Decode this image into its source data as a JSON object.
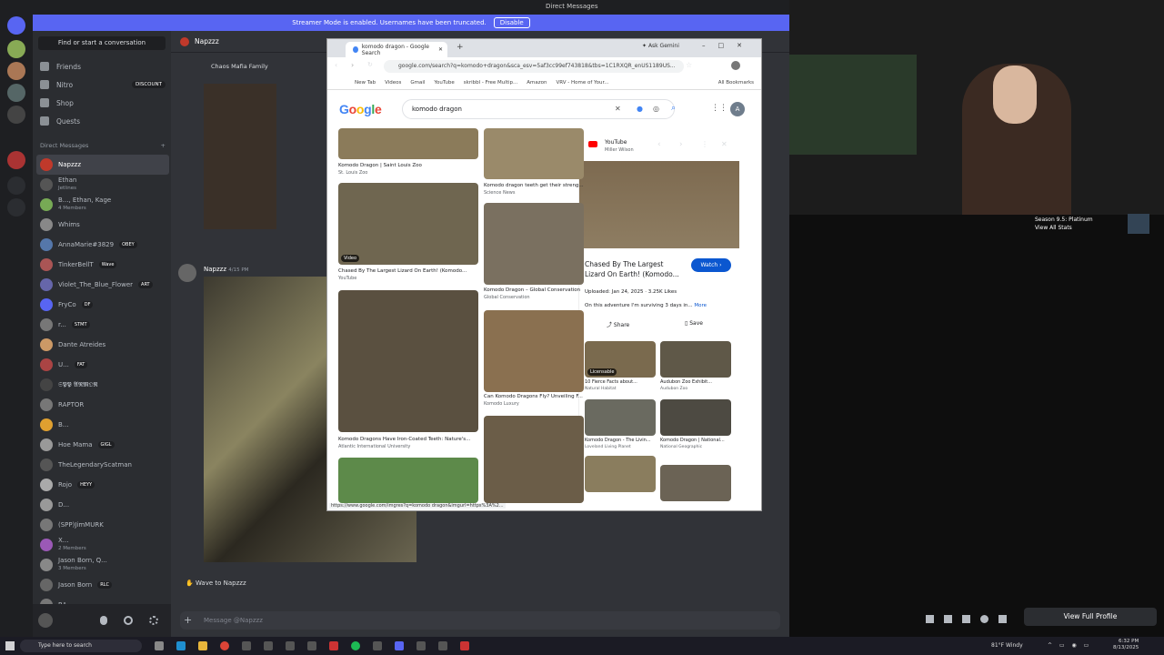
{
  "discord": {
    "window_title": "Direct Messages",
    "streamer_banner": "Streamer Mode is enabled. Usernames have been truncated.",
    "disable_label": "Disable",
    "find_placeholder": "Find or start a conversation",
    "nav": [
      {
        "label": "Friends"
      },
      {
        "label": "Nitro",
        "badge": "DISCOUNT"
      },
      {
        "label": "Shop"
      },
      {
        "label": "Quests"
      }
    ],
    "dm_header": "Direct Messages",
    "dms": [
      {
        "name": "Napzzz",
        "color": "#c0392b",
        "selected": true
      },
      {
        "name": "Ethan",
        "sub": "Jetlines",
        "color": "#555"
      },
      {
        "name": "B..., Ethan, Kage",
        "sub": "4 Members",
        "color": "#7a5"
      },
      {
        "name": "Whims",
        "color": "#888"
      },
      {
        "name": "AnnaMarie#3829",
        "tag": "OBEY",
        "color": "#57a"
      },
      {
        "name": "TinkerBellT",
        "tag": "Wave",
        "color": "#a55"
      },
      {
        "name": "Violet_The_Blue_Flower",
        "tag": "ART",
        "color": "#66a"
      },
      {
        "name": "FryCo",
        "tag": "DF",
        "color": "#5865f2"
      },
      {
        "name": "r...",
        "tag": "STMT",
        "color": "#777"
      },
      {
        "name": "Dante Atreides",
        "color": "#c96"
      },
      {
        "name": "U...",
        "tag": "FAT",
        "color": "#a44"
      },
      {
        "name": "𝕾𝕻𝕻 𝕬𝕽𝕸𝕺𝕽",
        "color": "#444"
      },
      {
        "name": "RAPTOR",
        "color": "#777"
      },
      {
        "name": "B...",
        "color": "#e0a030"
      },
      {
        "name": "Hoe Mama",
        "tag": "GIGL",
        "color": "#999"
      },
      {
        "name": "TheLegendaryScatman",
        "color": "#555"
      },
      {
        "name": "Rojo",
        "tag": "HEYY",
        "color": "#aaa"
      },
      {
        "name": "D...",
        "color": "#999"
      },
      {
        "name": "(SPP)JimMURK",
        "color": "#777"
      },
      {
        "name": "X...",
        "sub": "2 Members",
        "color": "#9b59b6"
      },
      {
        "name": "Jason Born, Q...",
        "sub": "3 Members",
        "color": "#888"
      },
      {
        "name": "Jason Born",
        "tag": "RLC",
        "color": "#666"
      },
      {
        "name": "RA",
        "color": "#777"
      }
    ],
    "chat_header": "Napzzz",
    "group_label": "Chaos Mafia Family",
    "message_author": "Napzzz",
    "message_time": "4/15 PM",
    "wave_label": "Wave to Napzzz",
    "input_placeholder": "Message @Napzzz",
    "profile": {
      "status": "Season 9.5: Platinum",
      "stats": "View All Stats",
      "view_full": "View Full Profile"
    }
  },
  "chrome": {
    "tab_title": "komodo dragon - Google Search",
    "ask_gemini": "Ask Gemini",
    "url": "google.com/search?q=komodo+dragon&sca_esv=5af3cc99ef743818&tbs=1C1RXQR_enUS1189US...",
    "bookmarks": [
      "New Tab",
      "Videos",
      "Gmail",
      "YouTube",
      "skribbl - Free Multip...",
      "Amazon",
      "VRV - Home of Your..."
    ],
    "all_bookmarks": "All Bookmarks",
    "search_query": "komodo dragon",
    "results": [
      {
        "caption": "Komodo Dragon | Saint Louis Zoo",
        "source": "St. Louis Zoo"
      },
      {
        "caption": "Komodo dragon teeth get their streng...",
        "source": "Science News"
      },
      {
        "caption": "Chased By The Largest Lizard On Earth! (Komodo...",
        "source": "YouTube",
        "badge": "Video"
      },
      {
        "caption": "Komodo Dragon – Global Conservation",
        "source": "Global Conservation"
      },
      {
        "caption": "Komodo Dragons Have Iron-Coated Teeth: Nature's...",
        "source": "Atlantic International University"
      },
      {
        "caption": "Can Komodo Dragons Fly? Unveiling F...",
        "source": "Komodo Luxury"
      }
    ],
    "status_url": "https://www.google.com/imgres?q=komodo dragon&imgurl=https%3A%2...",
    "side": {
      "source": "YouTube",
      "author": "Miller Wilson",
      "title": "Chased By The Largest Lizard On Earth! (Komodo...",
      "watch": "Watch",
      "uploaded": "Uploaded: Jan 24, 2025 · 3.25K Likes",
      "desc": "On this adventure I'm surviving 3 days in...",
      "more": "More",
      "share": "Share",
      "save": "Save",
      "related": [
        {
          "caption": "10 Fierce Facts about...",
          "source": "Natural Habitat",
          "badge": "Licensable"
        },
        {
          "caption": "Audubon Zoo Exhibit...",
          "source": "Audubon Zoo"
        },
        {
          "caption": "Komodo Dragon - The Livin...",
          "source": "Loveland Living Planet"
        },
        {
          "caption": "Komodo Dragon | National...",
          "source": "National Geographic"
        }
      ]
    }
  },
  "taskbar": {
    "search": "Type here to search",
    "weather": "81°F Windy",
    "time": "6:32 PM",
    "date": "8/13/2025"
  }
}
